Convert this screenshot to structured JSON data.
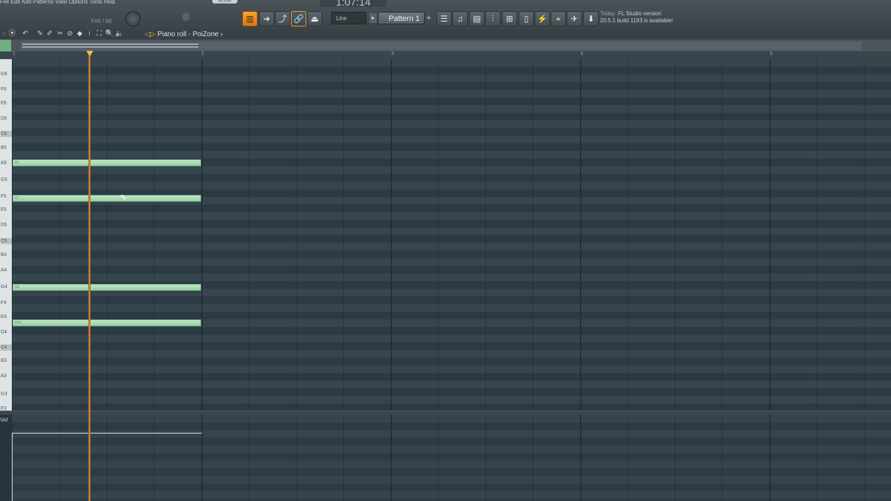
{
  "toolbar": {
    "menu_text": "File  Edit  Add  Patterns  View  Options  Tools  Help",
    "hint": "F#5 / 66",
    "time_display": "1:07:14",
    "tempo_display": "00.000",
    "snap_label": "Line",
    "pattern_label": "Pattern 1",
    "pattern_add": "+",
    "news_title": "Today",
    "news_line1": "FL Studio version",
    "news_line2": "20.5.1 build 1193 is available!"
  },
  "piano_roll": {
    "title": "Piano roll - PoiZone",
    "title_arrow": "◁▷",
    "title_chevron": "›"
  },
  "timeline": {
    "bars": [
      "1",
      "2",
      "3",
      "4",
      "5"
    ]
  },
  "keyboard": {
    "labels": [
      "G6",
      "F6",
      "E6",
      "D6",
      "C6",
      "B5",
      "A5",
      "G5",
      "F5",
      "E5",
      "D5",
      "C5",
      "B4",
      "A4",
      "G4",
      "F4",
      "E4",
      "D4",
      "C4",
      "B3",
      "A3",
      "G3",
      "F3"
    ]
  },
  "notes": [
    {
      "key": "A5",
      "label": "A5"
    },
    {
      "key": "F5",
      "label": "F5"
    },
    {
      "key": "G4",
      "label": "G4"
    },
    {
      "key": "D#4",
      "label": "D#4"
    }
  ],
  "event_lane": {
    "label": "Vel"
  },
  "colors": {
    "accent": "#f29a3c",
    "note_fill": "#a8d9b2",
    "grid_bg": "#2f3e48"
  }
}
